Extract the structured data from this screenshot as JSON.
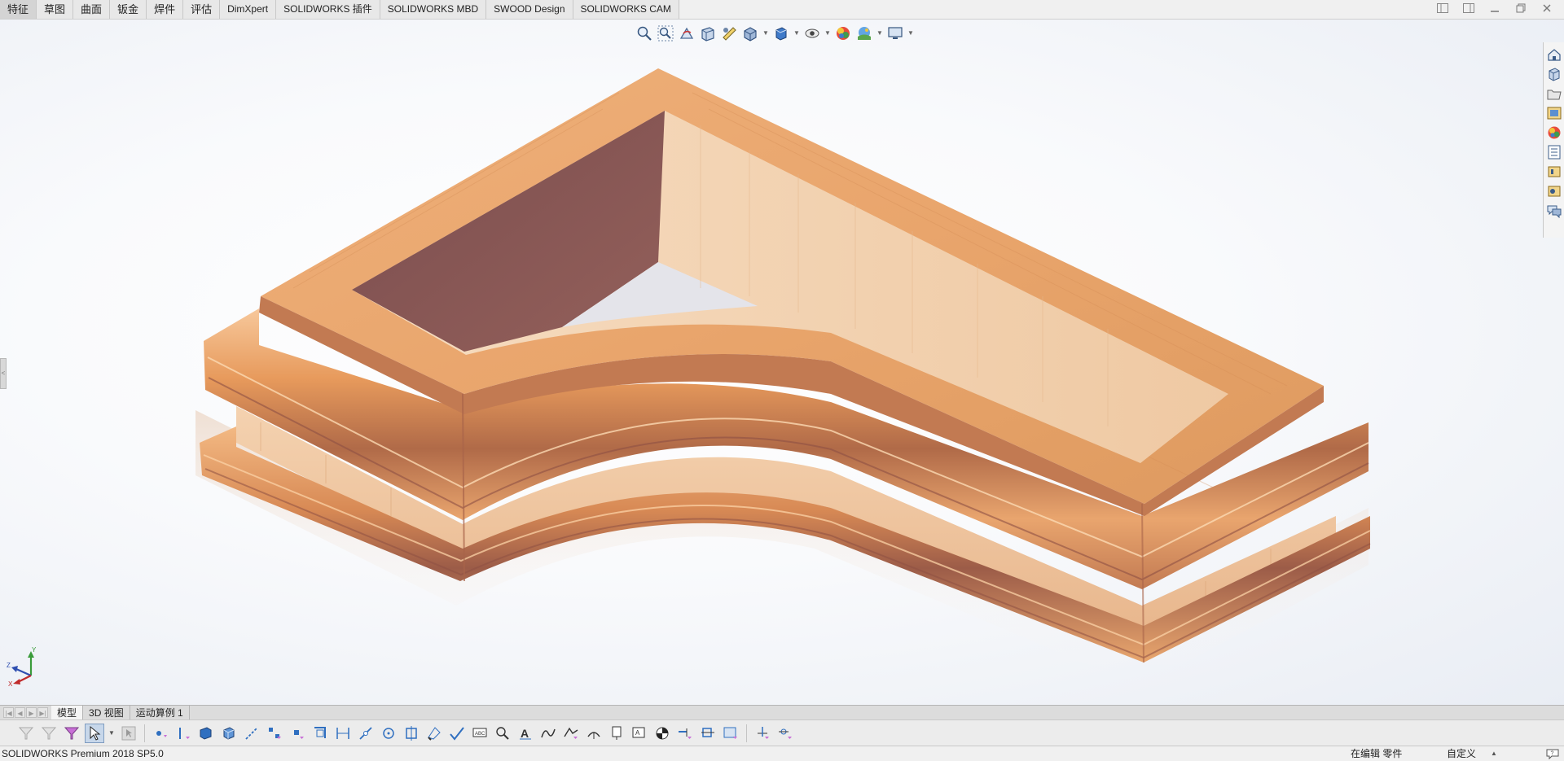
{
  "command_tabs": [
    {
      "label": "特征",
      "active": true
    },
    {
      "label": "草图"
    },
    {
      "label": "曲面"
    },
    {
      "label": "钣金"
    },
    {
      "label": "焊件"
    },
    {
      "label": "评估"
    },
    {
      "label": "DimXpert"
    },
    {
      "label": "SOLIDWORKS 插件"
    },
    {
      "label": "SOLIDWORKS MBD"
    },
    {
      "label": "SWOOD Design"
    },
    {
      "label": "SOLIDWORKS CAM"
    }
  ],
  "window_controls": [
    "tile-left-icon",
    "tile-right-icon",
    "minimize-icon",
    "restore-icon",
    "close-icon"
  ],
  "heads_up_toolbar": [
    "zoom-to-fit-icon",
    "zoom-to-area-icon",
    "previous-view-icon",
    "section-view-icon",
    "dynamic-annotation-icon",
    "view-orientation-icon",
    "display-style-icon",
    "hide-show-items-icon",
    "edit-appearance-icon",
    "apply-scene-icon",
    "view-settings-icon"
  ],
  "task_pane": [
    "solidworks-resources-icon",
    "design-library-icon",
    "file-explorer-icon",
    "view-palette-icon",
    "appearances-scenes-icon",
    "custom-properties-icon",
    "solidworks-forum-icon",
    "swood-icon",
    "comments-icon"
  ],
  "bottom_tabs": [
    {
      "label": "模型",
      "active": true
    },
    {
      "label": "3D 视图"
    },
    {
      "label": "运动算例 1"
    }
  ],
  "status": {
    "product": "SOLIDWORKS Premium 2018 SP5.0",
    "editing": "在编辑 零件",
    "units": "自定义"
  },
  "triad": {
    "y": "Y",
    "z": "Z",
    "x": "X"
  },
  "colors": {
    "wood_light": "#f2cfa8",
    "wood_mid": "#e8a66a",
    "wood_dark": "#a9654a",
    "interior_dark": "#8a5757",
    "accent_blue": "#2f6fc0"
  }
}
